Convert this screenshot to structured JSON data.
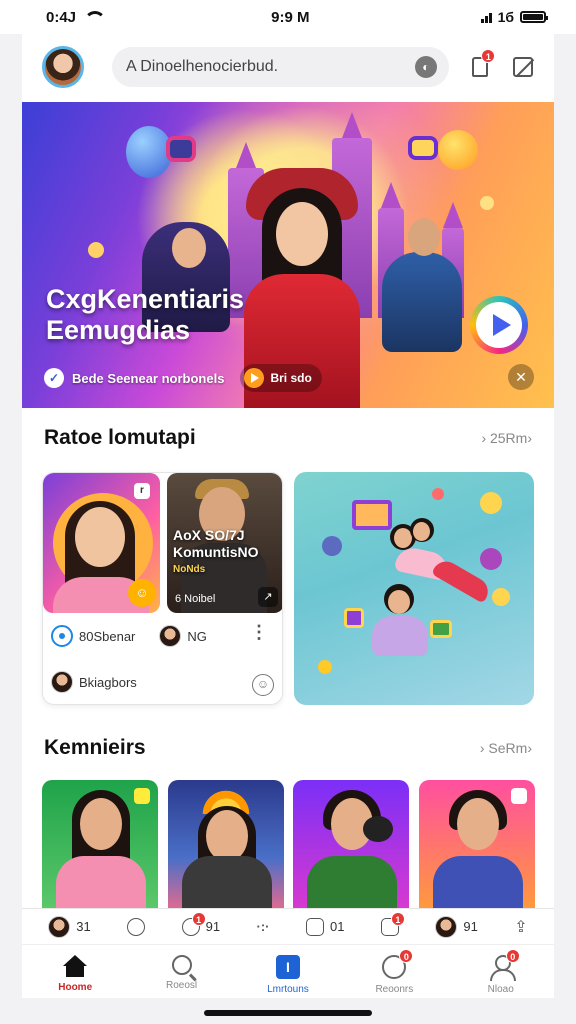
{
  "status_bar": {
    "time_left": "0:4J",
    "time_center": "9:9 M",
    "right_text": "1б"
  },
  "header": {
    "search_text": "A Dinoelhenocierbud.",
    "notification_badge": "1"
  },
  "hero": {
    "title_line1": "CxgKenentiaris",
    "title_line2": "Eemugdias",
    "meta_text": "Bede Seenear norbonels",
    "pill_text": "Bri sdo"
  },
  "section1": {
    "title": "Ratoe lomutapi",
    "link": "› 25Rm›",
    "card": {
      "thumb2_overlay_line1": "AoX SO/7J",
      "thumb2_overlay_line2": "KomuntisNO",
      "thumb2_overlay_line3": "NoNds",
      "thumb2_foot": "6 Noibel",
      "row1_text_a": "80Sbenar",
      "row1_text_b": "NG",
      "row2_text": "Bkiagbors"
    }
  },
  "section2": {
    "title": "Kemnieirs",
    "link": "› SeRm›"
  },
  "actions": [
    {
      "name": "avatar-count",
      "text": "31"
    },
    {
      "name": "info",
      "text": ""
    },
    {
      "name": "comments",
      "text": "91",
      "badge": "1"
    },
    {
      "name": "more",
      "text": ""
    },
    {
      "name": "edit",
      "text": "01"
    },
    {
      "name": "save",
      "text": "",
      "badge": "1"
    },
    {
      "name": "user-count",
      "text": "91"
    },
    {
      "name": "share",
      "text": ""
    }
  ],
  "tabs": [
    {
      "label": "Hoome",
      "icon": "home-icon"
    },
    {
      "label": "Roeosl",
      "icon": "search-icon"
    },
    {
      "label": "Lmrtouns",
      "icon": "box-icon"
    },
    {
      "label": "Reoonrs",
      "icon": "chat-icon",
      "badge": "0"
    },
    {
      "label": "Nloao",
      "icon": "person-icon",
      "badge": "0"
    }
  ],
  "colors": {
    "accent_red": "#c62828",
    "accent_blue": "#1e63d6",
    "badge": "#e53935"
  }
}
